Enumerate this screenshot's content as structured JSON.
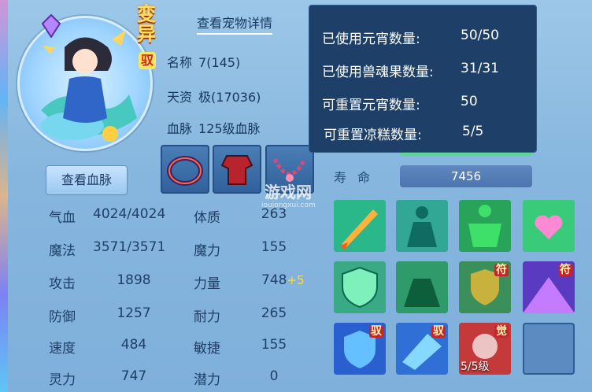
{
  "pet": {
    "transform_label": "变异",
    "ride_badge": "驭",
    "detail_button": "查看宠物详情",
    "name_label": "名称",
    "name_value": "7(145)",
    "aptitude_label": "天资",
    "aptitude_value": "极(17036)",
    "bloodline_label": "血脉",
    "bloodline_value": "125级血脉",
    "bloodline_button": "查看血脉"
  },
  "stats": {
    "hp_label": "气血",
    "hp_value": "4024/4024",
    "mp_label": "魔法",
    "mp_value": "3571/3571",
    "atk_label": "攻击",
    "atk_value": "1898",
    "def_label": "防御",
    "def_value": "1257",
    "spd_label": "速度",
    "spd_value": "484",
    "spirit_label": "灵力",
    "spirit_value": "747",
    "con_label": "体质",
    "con_value": "263",
    "mag_label": "魔力",
    "mag_value": "155",
    "str_label": "力量",
    "str_value": "748",
    "str_bonus": "+5",
    "end_label": "耐力",
    "end_value": "265",
    "agi_label": "敏捷",
    "agi_value": "155",
    "pot_label": "潜力",
    "pot_value": "0"
  },
  "life": {
    "label": "寿命",
    "value": "7456"
  },
  "tooltip": {
    "line1_label": "已使用元宵数量:",
    "line1_value": "50/50",
    "line2_label": "已使用兽魂果数量:",
    "line2_value": "31/31",
    "line3_label": "可重置元宵数量:",
    "line3_value": "50",
    "line4_label": "可重置凉糕数量:",
    "line4_value": "5/5"
  },
  "skills": {
    "tag_fu": "符",
    "tag_yu": "驭",
    "tag_jue": "觉",
    "level_text": "5/5级"
  },
  "watermark": {
    "main": "游戏网",
    "sub": "ioujongxui.com"
  },
  "colors": {
    "panel_bg": "#8ab8df",
    "tooltip_bg": "#1d3f68",
    "bar_green": "#52d68b",
    "accent_gold": "#ffe05a"
  }
}
